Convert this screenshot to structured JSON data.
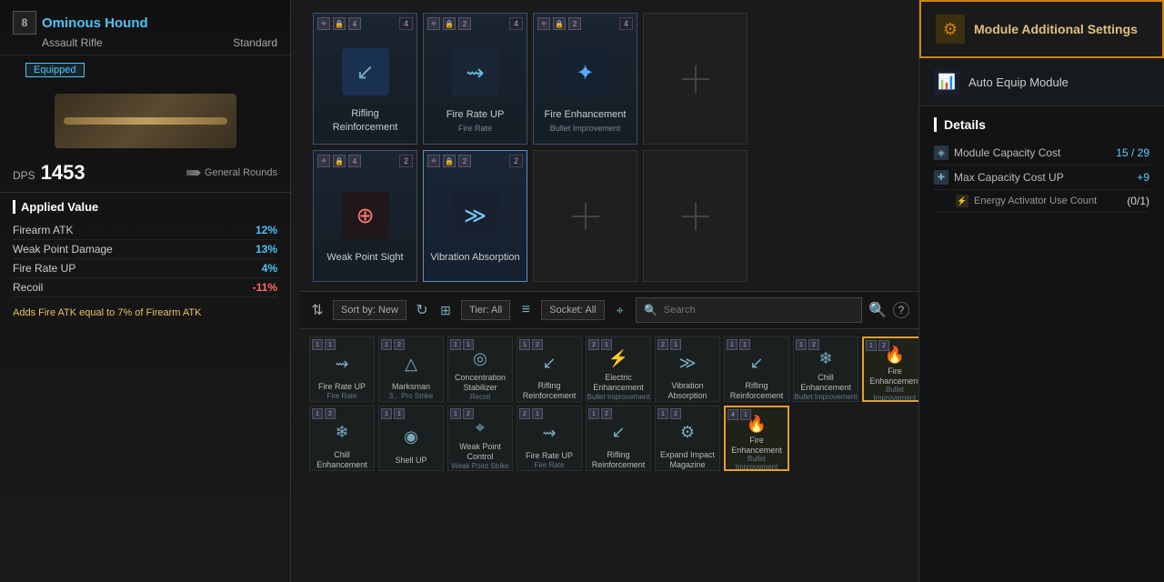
{
  "weapon": {
    "level": 8,
    "name": "Ominous Hound",
    "type": "Assault Rifle",
    "grade": "Standard",
    "equipped": "Equipped",
    "dps_label": "DPS",
    "dps_value": "1453",
    "ammo_type": "General Rounds"
  },
  "applied_value": {
    "title": "Applied Value",
    "stats": [
      {
        "name": "Firearm ATK",
        "value": "12%",
        "type": "positive"
      },
      {
        "name": "Weak Point Damage",
        "value": "13%",
        "type": "positive"
      },
      {
        "name": "Fire Rate UP",
        "value": "4%",
        "type": "positive"
      },
      {
        "name": "Recoil",
        "value": "-11%",
        "type": "negative"
      }
    ],
    "note": "Adds Fire ATK equal to 7% of Firearm ATK"
  },
  "equipped_modules": [
    {
      "name": "Rifling Reinforcement",
      "sub_type": "",
      "tier": "4",
      "socket": "4",
      "icon_type": "rifling",
      "empty": false
    },
    {
      "name": "Fire Rate UP",
      "sub_type": "Fire Rate",
      "tier": "2",
      "socket": "4",
      "icon_type": "firerate",
      "empty": false
    },
    {
      "name": "Fire Enhancement",
      "sub_type": "Bullet Improvement",
      "tier": "2",
      "socket": "4",
      "icon_type": "fire",
      "empty": false
    },
    {
      "name": "",
      "empty": true
    },
    {
      "name": "Weak Point Sight",
      "sub_type": "",
      "tier": "4",
      "socket": "2",
      "icon_type": "weak",
      "empty": false
    },
    {
      "name": "Vibration Absorption",
      "sub_type": "",
      "tier": "2",
      "socket": "2",
      "icon_type": "vibration",
      "empty": false,
      "active": true
    },
    {
      "name": "",
      "empty": true
    },
    {
      "name": "",
      "empty": true
    }
  ],
  "toolbar": {
    "sort_label": "Sort by: New",
    "tier_label": "Tier: All",
    "socket_label": "Socket: All",
    "search_placeholder": "Search"
  },
  "inventory": [
    {
      "name": "Fire Rate UP",
      "sub": "Fire Rate",
      "tier": "1",
      "socket": "1",
      "icon": "⇝",
      "count": ""
    },
    {
      "name": "Marksman",
      "sub": "3... Pro Strike",
      "tier": "1",
      "socket": "2",
      "icon": "△",
      "count": ""
    },
    {
      "name": "Concentration Stabilizer",
      "sub": "Recoil",
      "tier": "1",
      "socket": "1",
      "icon": "◎",
      "count": ""
    },
    {
      "name": "Rifling Reinforcement",
      "sub": "",
      "tier": "1",
      "socket": "2",
      "icon": "↙",
      "count": ""
    },
    {
      "name": "Electric Enhancement",
      "sub": "Bullet Improvement",
      "tier": "2",
      "socket": "1",
      "icon": "⚡",
      "count": ""
    },
    {
      "name": "Vibration Absorption",
      "sub": "",
      "tier": "2",
      "socket": "1",
      "icon": "≫",
      "count": ""
    },
    {
      "name": "Rifling Reinforcement",
      "sub": "",
      "tier": "1",
      "socket": "1",
      "icon": "↙",
      "count": ""
    },
    {
      "name": "Chill Enhancement",
      "sub": "Bullet Improvement",
      "tier": "1",
      "socket": "2",
      "icon": "❄",
      "count": ""
    },
    {
      "name": "Fire Enhancement",
      "sub": "Bullet Improvement",
      "tier": "1",
      "socket": "2",
      "icon": "🔥",
      "count": "",
      "highlighted": true
    },
    {
      "name": "Chill Enhancement",
      "sub": "",
      "tier": "1",
      "socket": "2",
      "icon": "❄",
      "count": ""
    },
    {
      "name": "Shell UP",
      "sub": "",
      "tier": "1",
      "socket": "1",
      "icon": "◉",
      "count": ""
    },
    {
      "name": "Weak Point Control",
      "sub": "Weak Point Strike",
      "tier": "1",
      "socket": "2",
      "icon": "⌖",
      "count": ""
    },
    {
      "name": "Fire Rate UP",
      "sub": "Fire Rate",
      "tier": "2",
      "socket": "1",
      "icon": "⇝",
      "count": ""
    },
    {
      "name": "Rifling Reinforcement",
      "sub": "",
      "tier": "1",
      "socket": "2",
      "icon": "↙",
      "count": ""
    },
    {
      "name": "Expand Impact Magazine",
      "sub": "",
      "tier": "1",
      "socket": "2",
      "icon": "⚙",
      "count": ""
    },
    {
      "name": "Fire Enhancement",
      "sub": "Bullet Improvement",
      "tier": "4",
      "socket": "1",
      "icon": "🔥",
      "count": "",
      "highlighted": true
    }
  ],
  "right_panel": {
    "settings_label": "Module Additional Settings",
    "auto_equip_label": "Auto Equip Module",
    "details_title": "Details",
    "module_capacity_cost_label": "Module Capacity Cost",
    "module_capacity_cost_value": "15 / 29",
    "max_capacity_label": "Max Capacity Cost UP",
    "max_capacity_value": "+9",
    "energy_activator_label": "Energy Activator Use Count",
    "energy_activator_value": "(0/1)"
  }
}
